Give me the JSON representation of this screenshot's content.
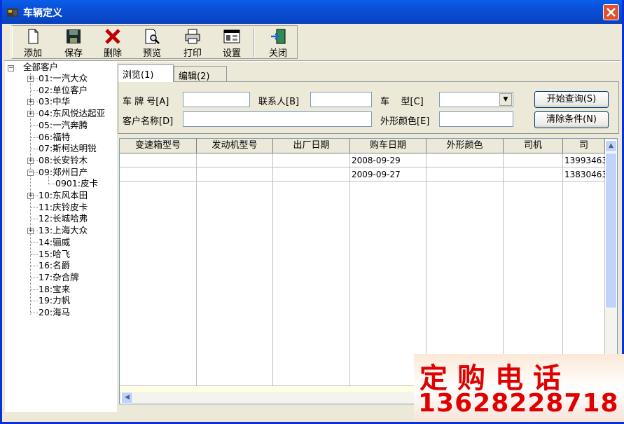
{
  "window": {
    "title": "车辆定义"
  },
  "toolbar": [
    {
      "label": "添加",
      "icon": "new-document-icon"
    },
    {
      "label": "保存",
      "icon": "save-disk-icon"
    },
    {
      "label": "删除",
      "icon": "delete-x-icon"
    },
    {
      "label": "预览",
      "icon": "preview-magnifier-icon"
    },
    {
      "label": "打印",
      "icon": "printer-icon"
    },
    {
      "label": "设置",
      "icon": "settings-icon"
    },
    {
      "label": "关闭",
      "icon": "exit-door-icon"
    }
  ],
  "tree": {
    "root": "全部客户",
    "items": [
      {
        "label": "01:一汽大众",
        "expandable": true
      },
      {
        "label": "02:单位客户",
        "expandable": false
      },
      {
        "label": "03:中华",
        "expandable": true
      },
      {
        "label": "04:东风悦达起亚",
        "expandable": true
      },
      {
        "label": "05:一汽奔腾",
        "expandable": false
      },
      {
        "label": "06:福特",
        "expandable": false
      },
      {
        "label": "07:斯柯达明锐",
        "expandable": false
      },
      {
        "label": "08:长安铃木",
        "expandable": true
      },
      {
        "label": "09:郑州日产",
        "expandable": true,
        "expanded": true
      },
      {
        "label": "0901:皮卡",
        "child": true
      },
      {
        "label": "10:东风本田",
        "expandable": true
      },
      {
        "label": "11:庆铃皮卡",
        "expandable": false
      },
      {
        "label": "12:长城哈弗",
        "expandable": false
      },
      {
        "label": "13:上海大众",
        "expandable": true
      },
      {
        "label": "14:骊威",
        "expandable": false
      },
      {
        "label": "15:哈飞",
        "expandable": false
      },
      {
        "label": "16:名爵",
        "expandable": false
      },
      {
        "label": "17:杂合牌",
        "expandable": false
      },
      {
        "label": "18:宝来",
        "expandable": false
      },
      {
        "label": "19:力帆",
        "expandable": false
      },
      {
        "label": "20:海马",
        "expandable": false
      }
    ]
  },
  "tabs": [
    {
      "label": "浏览(1)",
      "active": true
    },
    {
      "label": "编辑(2)",
      "active": false
    }
  ],
  "filters": {
    "plate_label": "车 牌 号[A]",
    "contact_label": "联系人[B]",
    "model_label": "车    型[C]",
    "customer_label": "客户名称[D]",
    "color_label": "外形颜色[E]",
    "plate_value": "",
    "contact_value": "",
    "model_value": "",
    "customer_value": "",
    "color_value": ""
  },
  "buttons": {
    "query": "开始查询(S)",
    "clear": "清除条件(N)"
  },
  "grid": {
    "columns": [
      "变速箱型号",
      "发动机型号",
      "出厂日期",
      "购车日期",
      "外形颜色",
      "司机",
      "司"
    ],
    "rows": [
      [
        "",
        "",
        "",
        "2008-09-29",
        "",
        "",
        "13993463"
      ],
      [
        "",
        "",
        "",
        "2009-09-27",
        "",
        "",
        "13830463"
      ]
    ]
  },
  "ad": {
    "line1": "定购电话",
    "line2": "13628228718"
  },
  "colors": {
    "title_bar": "#0A4ED6",
    "ad_text": "#E00000"
  }
}
